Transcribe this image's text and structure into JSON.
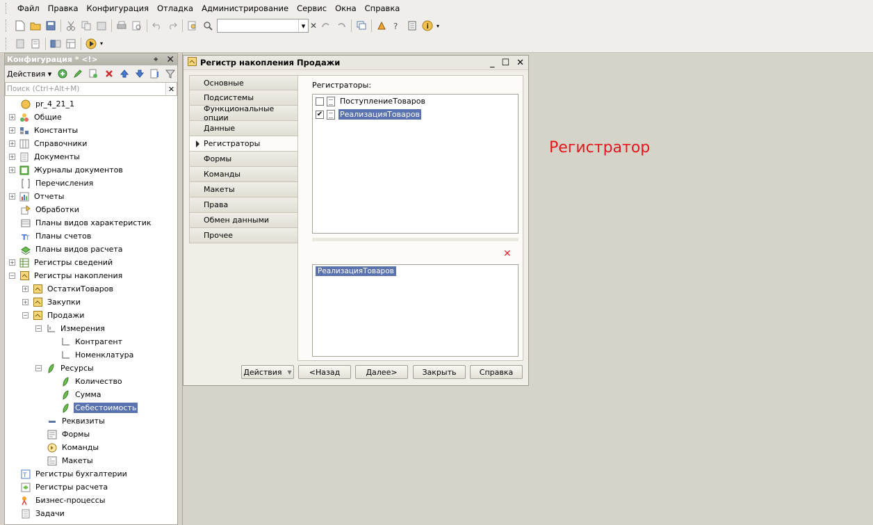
{
  "menubar": {
    "items": [
      "Файл",
      "Правка",
      "Конфигурация",
      "Отладка",
      "Администрирование",
      "Сервис",
      "Окна",
      "Справка"
    ]
  },
  "config_panel": {
    "title": "Конфигурация * <!>",
    "actions_label": "Действия",
    "search_placeholder": "Поиск (Ctrl+Alt+M)",
    "tree": [
      {
        "label": "pr_4_21_1",
        "icon": "config-root-icon",
        "level": 0,
        "expander": "none"
      },
      {
        "label": "Общие",
        "icon": "common-icon",
        "level": 0,
        "expander": "plus"
      },
      {
        "label": "Константы",
        "icon": "constants-icon",
        "level": 0,
        "expander": "plus"
      },
      {
        "label": "Справочники",
        "icon": "catalogs-icon",
        "level": 0,
        "expander": "plus"
      },
      {
        "label": "Документы",
        "icon": "documents-icon",
        "level": 0,
        "expander": "plus"
      },
      {
        "label": "Журналы документов",
        "icon": "document-journals-icon",
        "level": 0,
        "expander": "plus"
      },
      {
        "label": "Перечисления",
        "icon": "enumerations-icon",
        "level": 0,
        "expander": "none"
      },
      {
        "label": "Отчеты",
        "icon": "reports-icon",
        "level": 0,
        "expander": "plus"
      },
      {
        "label": "Обработки",
        "icon": "data-processors-icon",
        "level": 0,
        "expander": "none"
      },
      {
        "label": "Планы видов характеристик",
        "icon": "chart-of-characteristic-types-icon",
        "level": 0,
        "expander": "none"
      },
      {
        "label": "Планы счетов",
        "icon": "chart-of-accounts-icon",
        "level": 0,
        "expander": "none"
      },
      {
        "label": "Планы видов расчета",
        "icon": "chart-of-calculation-types-icon",
        "level": 0,
        "expander": "none"
      },
      {
        "label": "Регистры сведений",
        "icon": "information-registers-icon",
        "level": 0,
        "expander": "plus"
      },
      {
        "label": "Регистры накопления",
        "icon": "accumulation-registers-icon",
        "level": 0,
        "expander": "minus"
      },
      {
        "label": "ОстаткиТоваров",
        "icon": "accumulation-register-icon",
        "level": 1,
        "expander": "plus"
      },
      {
        "label": "Закупки",
        "icon": "accumulation-register-icon",
        "level": 1,
        "expander": "plus"
      },
      {
        "label": "Продажи",
        "icon": "accumulation-register-icon",
        "level": 1,
        "expander": "minus"
      },
      {
        "label": "Измерения",
        "icon": "dimensions-icon",
        "level": 2,
        "expander": "minus"
      },
      {
        "label": "Контрагент",
        "icon": "dimension-icon",
        "level": 3,
        "expander": "none"
      },
      {
        "label": "Номенклатура",
        "icon": "dimension-icon",
        "level": 3,
        "expander": "none"
      },
      {
        "label": "Ресурсы",
        "icon": "resources-icon",
        "level": 2,
        "expander": "minus"
      },
      {
        "label": "Количество",
        "icon": "resource-icon",
        "level": 3,
        "expander": "none"
      },
      {
        "label": "Сумма",
        "icon": "resource-icon",
        "level": 3,
        "expander": "none"
      },
      {
        "label": "Себестоимость",
        "icon": "resource-icon",
        "level": 3,
        "expander": "none",
        "selected": true
      },
      {
        "label": "Реквизиты",
        "icon": "attributes-icon",
        "level": 2,
        "expander": "none"
      },
      {
        "label": "Формы",
        "icon": "forms-icon",
        "level": 2,
        "expander": "none"
      },
      {
        "label": "Команды",
        "icon": "commands-icon",
        "level": 2,
        "expander": "none"
      },
      {
        "label": "Макеты",
        "icon": "templates-icon",
        "level": 2,
        "expander": "none"
      },
      {
        "label": "Регистры бухгалтерии",
        "icon": "accounting-registers-icon",
        "level": 0,
        "expander": "none"
      },
      {
        "label": "Регистры расчета",
        "icon": "calculation-registers-icon",
        "level": 0,
        "expander": "none"
      },
      {
        "label": "Бизнес-процессы",
        "icon": "business-processes-icon",
        "level": 0,
        "expander": "none"
      },
      {
        "label": "Задачи",
        "icon": "tasks-icon",
        "level": 0,
        "expander": "none"
      }
    ]
  },
  "dialog": {
    "title": "Регистр накопления Продажи",
    "tabs": [
      "Основные",
      "Подсистемы",
      "Функциональные опции",
      "Данные",
      "Регистраторы",
      "Формы",
      "Команды",
      "Макеты",
      "Права",
      "Обмен данными",
      "Прочее"
    ],
    "active_tab": 4,
    "registrators_label": "Регистраторы:",
    "registrators": [
      {
        "label": "ПоступлениеТоваров",
        "checked": false,
        "selected": false
      },
      {
        "label": "РеализацияТоваров",
        "checked": true,
        "selected": true
      }
    ],
    "selected_item": "РеализацияТоваров",
    "buttons": {
      "actions": "Действия",
      "back": "<Назад",
      "next": "Далее>",
      "close": "Закрыть",
      "help": "Справка"
    }
  },
  "annotation": "Регистратор",
  "colors": {
    "selection": "#5a72b0",
    "annotation": "#e3171c",
    "workspace": "#d6d3c9"
  }
}
